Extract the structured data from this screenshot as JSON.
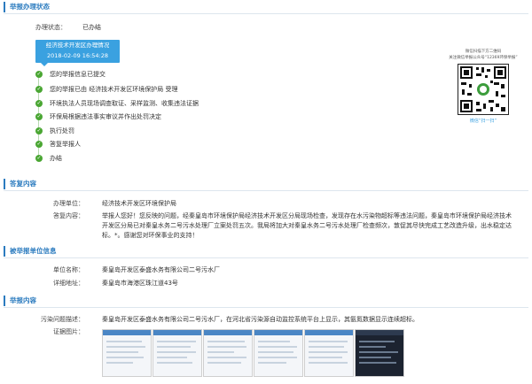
{
  "section1": {
    "title": "举报办理状态",
    "status_label": "办理状态：",
    "status_value": "已办结",
    "box_title": "经济技术开发区办理情况",
    "box_time": "2018-02-09 16:54:28",
    "steps": [
      "您的举报信息已提交",
      "您的举报已由 经济技术开发区环境保护局 受理",
      "环境执法人员现场调查取证、采样监测、收集违法证据",
      "环保局根据违法事实审议并作出处罚决定",
      "执行处罚",
      "答复举报人",
      "办结"
    ],
    "qr_caption_1": "微信扫描下方二维码",
    "qr_caption_2": "关注微信举报公众号“12369环保举报”",
    "qr_footer": "微信“扫一扫”"
  },
  "section2": {
    "title": "答复内容",
    "unit_label": "办理单位：",
    "unit_value": "经济技术开发区环境保护局",
    "reply_label": "答复内容：",
    "reply_text": "举报人您好！您反映的问题，经秦皇岛市环境保护局经济技术开发区分局现场检查，发现存在水污染物超标等违法问题，秦皇岛市环境保护局经济技术开发区分局已对秦皇水务二号污水处理厂立案处罚五次。我局将加大对秦皇水务二号污水处理厂检查频次，敦促其尽快完成工艺改造升级，出水稳定达标。*。感谢您对环保事业的支持！"
  },
  "section3": {
    "title": "被举报单位信息",
    "name_label": "单位名称：",
    "name_value": "秦皇岛开发区泰盛水务有限公司二号污水厂",
    "addr_label": "详细地址：",
    "addr_value": "秦皇岛市海港区珠江道43号"
  },
  "section4": {
    "title": "举报内容",
    "problem_label": "污染问题描述：",
    "problem_value": "秦皇岛开发区泰盛水务有限公司二号污水厂，在河北省污染源自动监控系统平台上显示，其氨氮数据显示连续超标。",
    "evidence_label": "证据图片："
  },
  "colors": {
    "accent": "#2b7bbf",
    "status_box": "#3aa1e0",
    "step_green": "#4aa633"
  }
}
